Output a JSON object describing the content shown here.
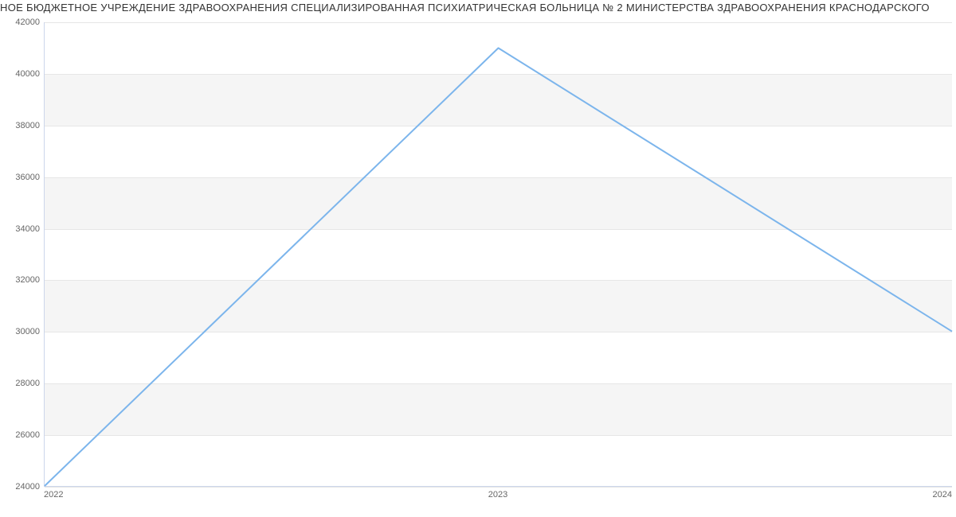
{
  "chart_data": {
    "type": "line",
    "title": "НОЕ БЮДЖЕТНОЕ УЧРЕЖДЕНИЕ ЗДРАВООХРАНЕНИЯ  СПЕЦИАЛИЗИРОВАННАЯ ПСИХИАТРИЧЕСКАЯ БОЛЬНИЦА № 2 МИНИСТЕРСТВА ЗДРАВООХРАНЕНИЯ КРАСНОДАРСКОГО",
    "x": [
      2022,
      2023,
      2024
    ],
    "categories": [
      "2022",
      "2023",
      "2024"
    ],
    "values": [
      24000,
      41000,
      30000
    ],
    "xlabel": "",
    "ylabel": "",
    "ylim": [
      24000,
      42000
    ],
    "yticks": [
      24000,
      26000,
      28000,
      30000,
      32000,
      34000,
      36000,
      38000,
      40000,
      42000
    ],
    "xlim": [
      2022,
      2024
    ]
  },
  "colors": {
    "series": "#7cb5ec",
    "band": "#f5f5f5"
  }
}
